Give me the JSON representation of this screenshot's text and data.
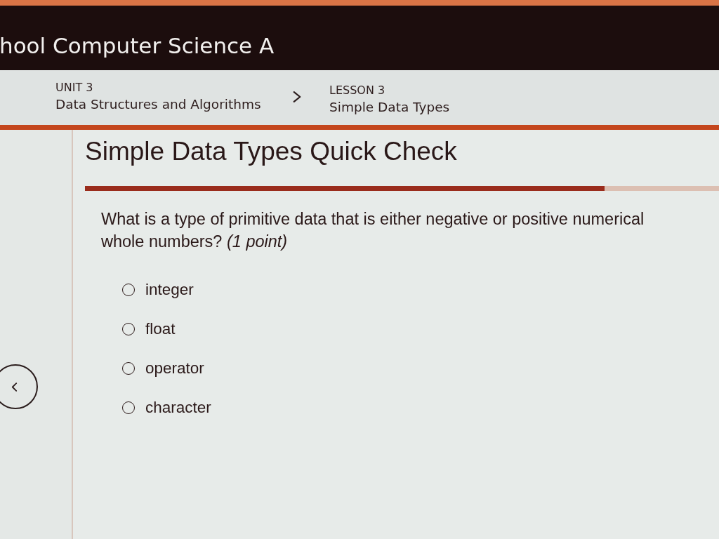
{
  "header": {
    "title": "hool Computer Science A"
  },
  "breadcrumb": {
    "unit": {
      "label": "UNIT 3",
      "title": "Data Structures and Algorithms"
    },
    "lesson": {
      "label": "LESSON 3",
      "title": "Simple Data Types"
    }
  },
  "quiz": {
    "title": "Simple Data Types Quick Check",
    "progress": {
      "level": 0.82
    },
    "question": "What is a type of primitive data that is either negative or positive numerical whole numbers? *(1 point)*",
    "options": [
      {
        "label": "integer",
        "selected": false
      },
      {
        "label": "float",
        "selected": false
      },
      {
        "label": "operator",
        "selected": false
      },
      {
        "label": "character",
        "selected": false
      }
    ]
  }
}
